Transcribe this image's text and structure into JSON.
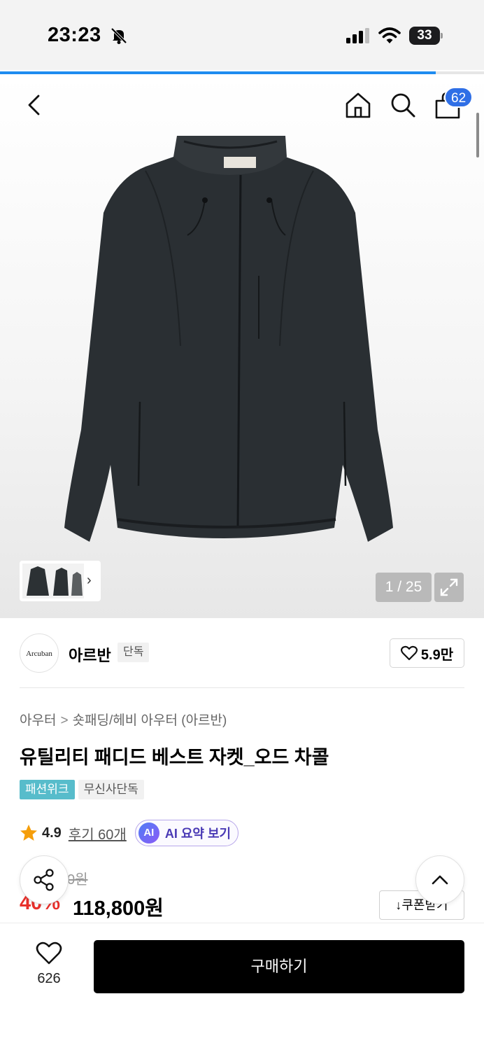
{
  "status_bar": {
    "time": "23:23",
    "battery": "33",
    "icons": [
      "bell-slash-icon",
      "signal-icon",
      "wifi-icon",
      "battery-icon"
    ]
  },
  "page_progress": 0.9,
  "header": {
    "cart_count": "62",
    "icons": [
      "back-icon",
      "home-icon",
      "search-icon",
      "cart-icon"
    ]
  },
  "gallery": {
    "counter": "1 / 25",
    "thumb_more": "›"
  },
  "brand": {
    "logo_text": "Arcuban",
    "name": "아르반",
    "tag": "단독",
    "likes": "5.9만"
  },
  "breadcrumb": {
    "level1": "아우터",
    "separator": ">",
    "level2": "숏패딩/헤비 아우터 (아르반)"
  },
  "product": {
    "title": "유틸리티 패디드 베스트 자켓_오드 차콜",
    "tags": [
      "패션위크",
      "무신사단독"
    ],
    "rating": "4.9",
    "reviews": "후기 60개",
    "ai_badge": "AI",
    "ai_label": "AI 요약 보기",
    "original_price": "0원",
    "discount": "40%",
    "price": "118,800원",
    "coupon": "↓쿠폰받기"
  },
  "bottom_bar": {
    "wish_count": "626",
    "buy_label": "구매하기"
  },
  "colors": {
    "accent_blue": "#2f6fe6",
    "discount_red": "#e8302b",
    "tag_teal": "#57bccb",
    "ai_purple": "#4a3ab5"
  }
}
